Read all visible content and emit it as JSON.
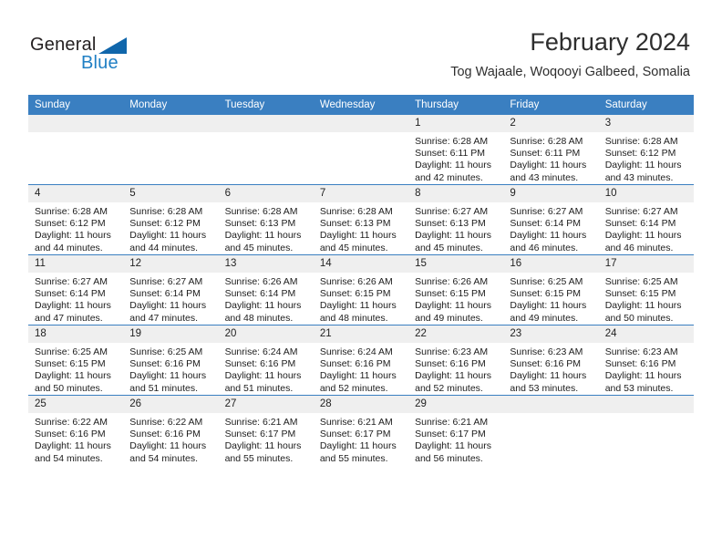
{
  "brand": {
    "name_top": "General",
    "name_bottom": "Blue",
    "triangle_color": "#1066ab",
    "blue_color": "#1f7fc4"
  },
  "header": {
    "title": "February 2024",
    "subtitle": "Tog Wajaale, Woqooyi Galbeed, Somalia",
    "header_bg": "#3a7fc1"
  },
  "weekdays": [
    "Sunday",
    "Monday",
    "Tuesday",
    "Wednesday",
    "Thursday",
    "Friday",
    "Saturday"
  ],
  "labels": {
    "sunrise": "Sunrise:",
    "sunset": "Sunset:",
    "daylight": "Daylight:"
  },
  "weeks": [
    [
      {
        "num": "",
        "empty": true
      },
      {
        "num": "",
        "empty": true
      },
      {
        "num": "",
        "empty": true
      },
      {
        "num": "",
        "empty": true
      },
      {
        "num": "1",
        "sunrise": "Sunrise: 6:28 AM",
        "sunset": "Sunset: 6:11 PM",
        "daylight1": "Daylight: 11 hours",
        "daylight2": "and 42 minutes."
      },
      {
        "num": "2",
        "sunrise": "Sunrise: 6:28 AM",
        "sunset": "Sunset: 6:11 PM",
        "daylight1": "Daylight: 11 hours",
        "daylight2": "and 43 minutes."
      },
      {
        "num": "3",
        "sunrise": "Sunrise: 6:28 AM",
        "sunset": "Sunset: 6:12 PM",
        "daylight1": "Daylight: 11 hours",
        "daylight2": "and 43 minutes."
      }
    ],
    [
      {
        "num": "4",
        "sunrise": "Sunrise: 6:28 AM",
        "sunset": "Sunset: 6:12 PM",
        "daylight1": "Daylight: 11 hours",
        "daylight2": "and 44 minutes."
      },
      {
        "num": "5",
        "sunrise": "Sunrise: 6:28 AM",
        "sunset": "Sunset: 6:12 PM",
        "daylight1": "Daylight: 11 hours",
        "daylight2": "and 44 minutes."
      },
      {
        "num": "6",
        "sunrise": "Sunrise: 6:28 AM",
        "sunset": "Sunset: 6:13 PM",
        "daylight1": "Daylight: 11 hours",
        "daylight2": "and 45 minutes."
      },
      {
        "num": "7",
        "sunrise": "Sunrise: 6:28 AM",
        "sunset": "Sunset: 6:13 PM",
        "daylight1": "Daylight: 11 hours",
        "daylight2": "and 45 minutes."
      },
      {
        "num": "8",
        "sunrise": "Sunrise: 6:27 AM",
        "sunset": "Sunset: 6:13 PM",
        "daylight1": "Daylight: 11 hours",
        "daylight2": "and 45 minutes."
      },
      {
        "num": "9",
        "sunrise": "Sunrise: 6:27 AM",
        "sunset": "Sunset: 6:14 PM",
        "daylight1": "Daylight: 11 hours",
        "daylight2": "and 46 minutes."
      },
      {
        "num": "10",
        "sunrise": "Sunrise: 6:27 AM",
        "sunset": "Sunset: 6:14 PM",
        "daylight1": "Daylight: 11 hours",
        "daylight2": "and 46 minutes."
      }
    ],
    [
      {
        "num": "11",
        "sunrise": "Sunrise: 6:27 AM",
        "sunset": "Sunset: 6:14 PM",
        "daylight1": "Daylight: 11 hours",
        "daylight2": "and 47 minutes."
      },
      {
        "num": "12",
        "sunrise": "Sunrise: 6:27 AM",
        "sunset": "Sunset: 6:14 PM",
        "daylight1": "Daylight: 11 hours",
        "daylight2": "and 47 minutes."
      },
      {
        "num": "13",
        "sunrise": "Sunrise: 6:26 AM",
        "sunset": "Sunset: 6:14 PM",
        "daylight1": "Daylight: 11 hours",
        "daylight2": "and 48 minutes."
      },
      {
        "num": "14",
        "sunrise": "Sunrise: 6:26 AM",
        "sunset": "Sunset: 6:15 PM",
        "daylight1": "Daylight: 11 hours",
        "daylight2": "and 48 minutes."
      },
      {
        "num": "15",
        "sunrise": "Sunrise: 6:26 AM",
        "sunset": "Sunset: 6:15 PM",
        "daylight1": "Daylight: 11 hours",
        "daylight2": "and 49 minutes."
      },
      {
        "num": "16",
        "sunrise": "Sunrise: 6:25 AM",
        "sunset": "Sunset: 6:15 PM",
        "daylight1": "Daylight: 11 hours",
        "daylight2": "and 49 minutes."
      },
      {
        "num": "17",
        "sunrise": "Sunrise: 6:25 AM",
        "sunset": "Sunset: 6:15 PM",
        "daylight1": "Daylight: 11 hours",
        "daylight2": "and 50 minutes."
      }
    ],
    [
      {
        "num": "18",
        "sunrise": "Sunrise: 6:25 AM",
        "sunset": "Sunset: 6:15 PM",
        "daylight1": "Daylight: 11 hours",
        "daylight2": "and 50 minutes."
      },
      {
        "num": "19",
        "sunrise": "Sunrise: 6:25 AM",
        "sunset": "Sunset: 6:16 PM",
        "daylight1": "Daylight: 11 hours",
        "daylight2": "and 51 minutes."
      },
      {
        "num": "20",
        "sunrise": "Sunrise: 6:24 AM",
        "sunset": "Sunset: 6:16 PM",
        "daylight1": "Daylight: 11 hours",
        "daylight2": "and 51 minutes."
      },
      {
        "num": "21",
        "sunrise": "Sunrise: 6:24 AM",
        "sunset": "Sunset: 6:16 PM",
        "daylight1": "Daylight: 11 hours",
        "daylight2": "and 52 minutes."
      },
      {
        "num": "22",
        "sunrise": "Sunrise: 6:23 AM",
        "sunset": "Sunset: 6:16 PM",
        "daylight1": "Daylight: 11 hours",
        "daylight2": "and 52 minutes."
      },
      {
        "num": "23",
        "sunrise": "Sunrise: 6:23 AM",
        "sunset": "Sunset: 6:16 PM",
        "daylight1": "Daylight: 11 hours",
        "daylight2": "and 53 minutes."
      },
      {
        "num": "24",
        "sunrise": "Sunrise: 6:23 AM",
        "sunset": "Sunset: 6:16 PM",
        "daylight1": "Daylight: 11 hours",
        "daylight2": "and 53 minutes."
      }
    ],
    [
      {
        "num": "25",
        "sunrise": "Sunrise: 6:22 AM",
        "sunset": "Sunset: 6:16 PM",
        "daylight1": "Daylight: 11 hours",
        "daylight2": "and 54 minutes."
      },
      {
        "num": "26",
        "sunrise": "Sunrise: 6:22 AM",
        "sunset": "Sunset: 6:16 PM",
        "daylight1": "Daylight: 11 hours",
        "daylight2": "and 54 minutes."
      },
      {
        "num": "27",
        "sunrise": "Sunrise: 6:21 AM",
        "sunset": "Sunset: 6:17 PM",
        "daylight1": "Daylight: 11 hours",
        "daylight2": "and 55 minutes."
      },
      {
        "num": "28",
        "sunrise": "Sunrise: 6:21 AM",
        "sunset": "Sunset: 6:17 PM",
        "daylight1": "Daylight: 11 hours",
        "daylight2": "and 55 minutes."
      },
      {
        "num": "29",
        "sunrise": "Sunrise: 6:21 AM",
        "sunset": "Sunset: 6:17 PM",
        "daylight1": "Daylight: 11 hours",
        "daylight2": "and 56 minutes."
      },
      {
        "num": "",
        "empty": true
      },
      {
        "num": "",
        "empty": true
      }
    ]
  ]
}
